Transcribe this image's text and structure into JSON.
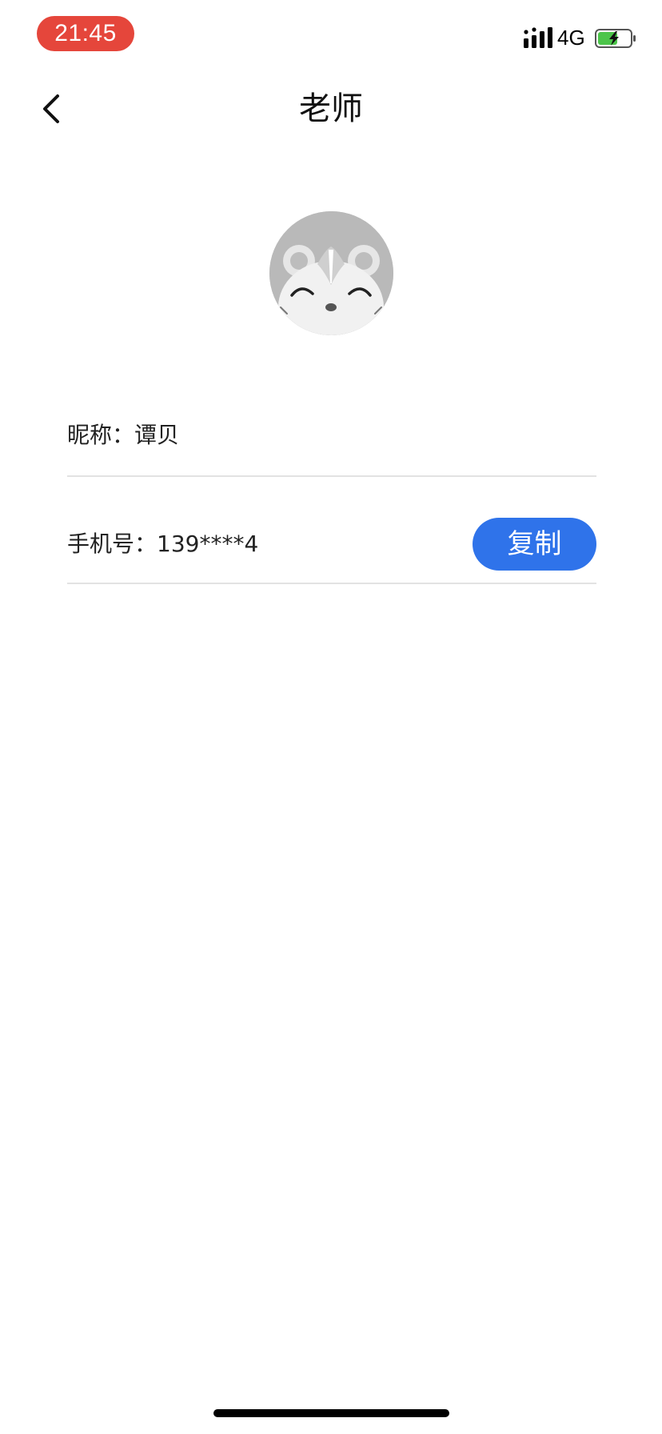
{
  "status_bar": {
    "time": "21:45",
    "network": "4G",
    "signal_icon": "signal-bars-icon",
    "battery_icon": "battery-charging-icon",
    "time_pill_color": "#e5463b",
    "battery_color": "#4cc54a"
  },
  "nav": {
    "title": "老师",
    "back_icon": "chevron-left-icon"
  },
  "profile": {
    "avatar_icon": "hamster-avatar-icon",
    "nickname_label": "昵称：",
    "nickname_value": "谭贝",
    "phone_label": "手机号：",
    "phone_value": "139****4",
    "copy_button": "复制",
    "copy_button_color": "#2f73ea"
  }
}
